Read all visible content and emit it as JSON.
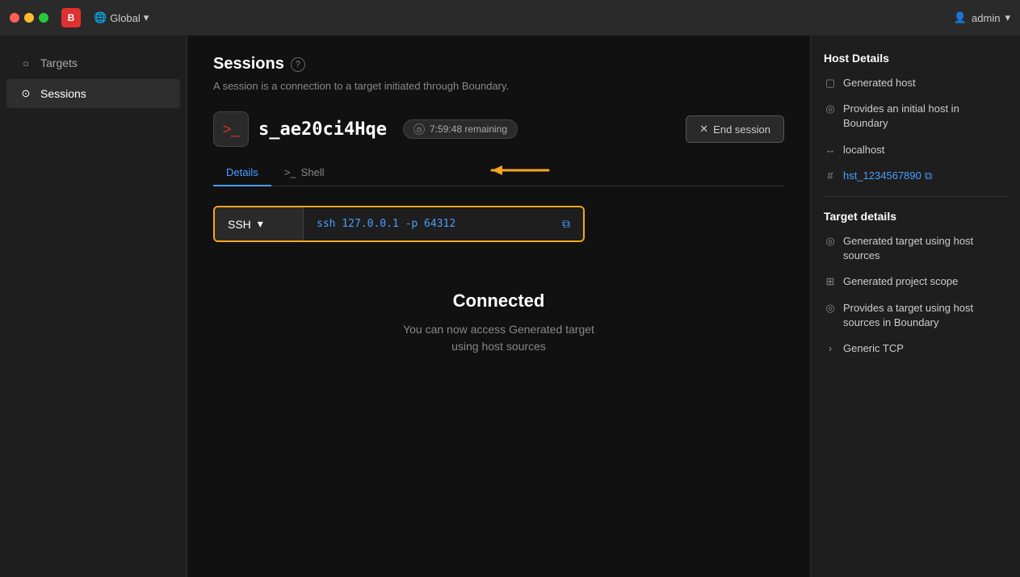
{
  "titlebar": {
    "global_label": "Global",
    "admin_label": "admin",
    "app_logo": "B"
  },
  "sidebar": {
    "items": [
      {
        "id": "targets",
        "label": "Targets",
        "icon": "○"
      },
      {
        "id": "sessions",
        "label": "Sessions",
        "icon": "⊙",
        "active": true
      }
    ]
  },
  "page": {
    "title": "Sessions",
    "help_icon": "?",
    "subtitle": "A session is a connection to a target initiated through Boundary.",
    "session_id": "s_ae20ci4Hqe",
    "time_remaining": "7:59:48 remaining",
    "end_session_label": "End session",
    "tabs": [
      {
        "id": "details",
        "label": "Details",
        "active": true
      },
      {
        "id": "shell",
        "label": "Shell",
        "active": false
      }
    ],
    "ssh_protocol": "SSH",
    "ssh_command": "ssh 127.0.0.1 -p 64312",
    "connected_title": "Connected",
    "connected_desc_line1": "You can now access Generated target",
    "connected_desc_line2": "using host sources"
  },
  "right_panel": {
    "host_details_title": "Host Details",
    "host_items": [
      {
        "icon": "monitor",
        "text": "Generated host"
      },
      {
        "icon": "target",
        "text": "Provides an initial host in Boundary"
      },
      {
        "icon": "arrows",
        "text": "localhost"
      },
      {
        "icon": "hash",
        "text": "hst_1234567890",
        "is_id": true
      }
    ],
    "target_details_title": "Target details",
    "target_items": [
      {
        "icon": "target",
        "text": "Generated target using host sources"
      },
      {
        "icon": "grid",
        "text": "Generated project scope"
      },
      {
        "icon": "target2",
        "text": "Provides a target using host sources in Boundary"
      },
      {
        "icon": "arrow-right",
        "text": "Generic TCP"
      }
    ]
  }
}
